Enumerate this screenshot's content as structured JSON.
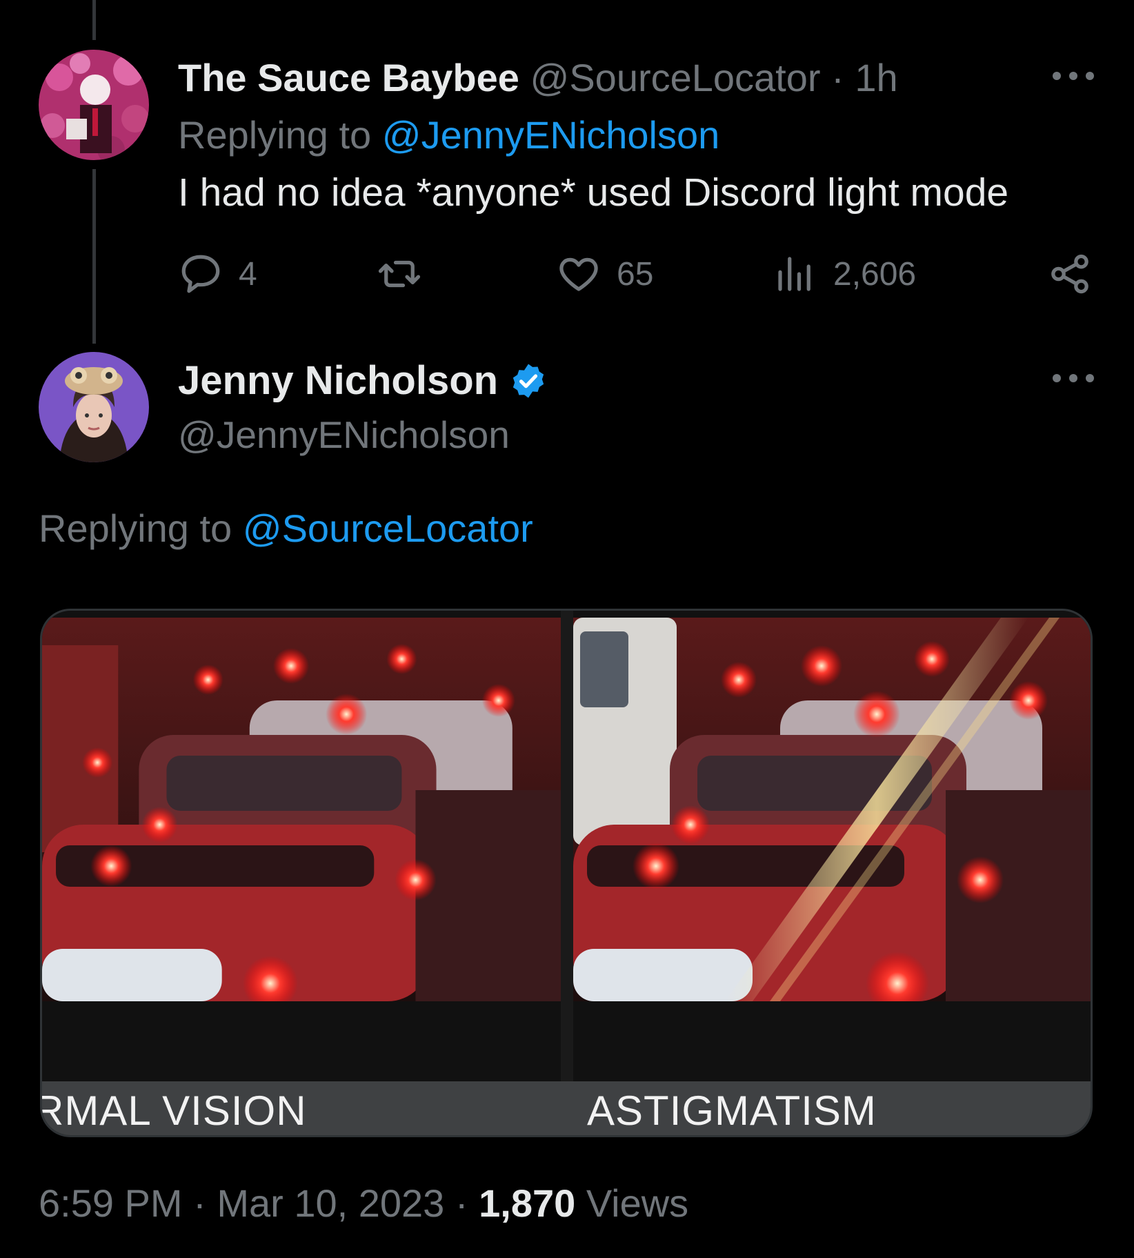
{
  "thread": {
    "reply_tweet": {
      "display_name": "The Sauce Baybee",
      "handle": "@SourceLocator",
      "separator": "·",
      "time_ago": "1h",
      "replying_prefix": "Replying to",
      "replying_to": "@JennyENicholson",
      "text": "I had no idea *anyone* used Discord light mode",
      "stats": {
        "replies": "4",
        "likes": "65",
        "views": "2,606"
      }
    },
    "main_tweet": {
      "display_name": "Jenny Nicholson",
      "handle": "@JennyENicholson",
      "verified": true,
      "replying_prefix": "Replying to",
      "replying_to": "@SourceLocator",
      "media": {
        "left_caption": "RMAL VISION",
        "right_caption": "ASTIGMATISM"
      },
      "footer": {
        "time": "6:59 PM",
        "sep1": "·",
        "date": "Mar 10, 2023",
        "sep2": "·",
        "views_count": "1,870",
        "views_label": "Views"
      }
    }
  },
  "colors": {
    "background": "#000000",
    "text": "#e7e9ea",
    "muted": "#71767b",
    "link": "#1d9bf0"
  },
  "icons": [
    "more-icon",
    "reply-icon",
    "retweet-icon",
    "like-icon",
    "views-icon",
    "share-icon",
    "verified-badge-icon"
  ]
}
